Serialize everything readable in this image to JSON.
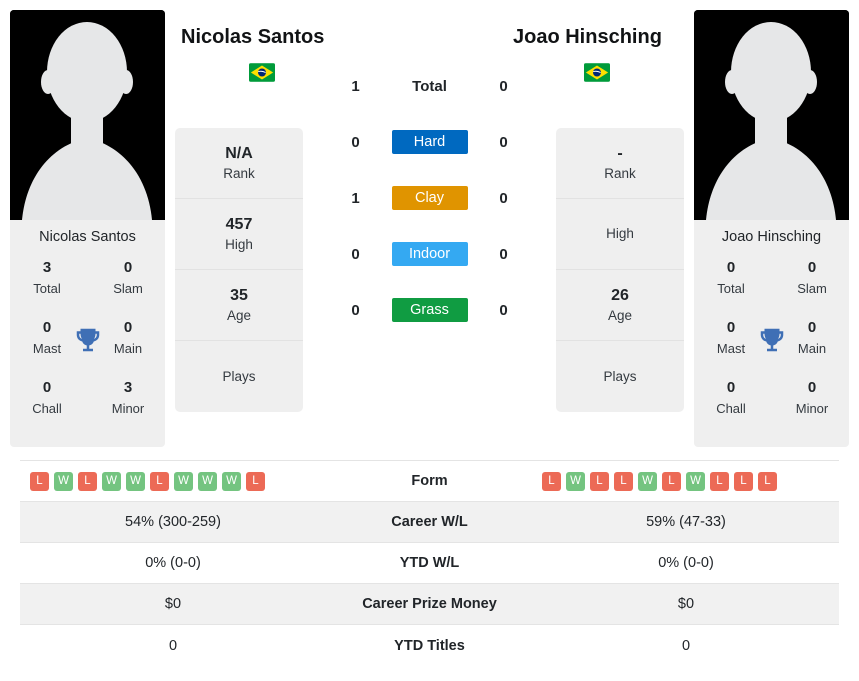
{
  "players": {
    "left": {
      "name": "Nicolas Santos",
      "photo_caption": "Nicolas Santos",
      "country": "Brazil",
      "flag": "brazil-flag",
      "titles": {
        "total_value": "3",
        "total_label": "Total",
        "slam_value": "0",
        "slam_label": "Slam",
        "mast_value": "0",
        "mast_label": "Mast",
        "main_value": "0",
        "main_label": "Main",
        "chall_value": "0",
        "chall_label": "Chall",
        "minor_value": "3",
        "minor_label": "Minor"
      },
      "info": [
        {
          "value": "N/A",
          "label": "Rank"
        },
        {
          "value": "457",
          "label": "High"
        },
        {
          "value": "35",
          "label": "Age"
        },
        {
          "value": "",
          "label": "Plays"
        }
      ],
      "form": [
        "L",
        "W",
        "L",
        "W",
        "W",
        "L",
        "W",
        "W",
        "W",
        "L"
      ],
      "career_wl": "54% (300-259)",
      "ytd_wl": "0% (0-0)",
      "career_prize_money": "$0",
      "ytd_titles": "0"
    },
    "right": {
      "name": "Joao Hinsching",
      "photo_caption": "Joao Hinsching",
      "country": "Brazil",
      "flag": "brazil-flag",
      "titles": {
        "total_value": "0",
        "total_label": "Total",
        "slam_value": "0",
        "slam_label": "Slam",
        "mast_value": "0",
        "mast_label": "Mast",
        "main_value": "0",
        "main_label": "Main",
        "chall_value": "0",
        "chall_label": "Chall",
        "minor_value": "0",
        "minor_label": "Minor"
      },
      "info": [
        {
          "value": "-",
          "label": "Rank"
        },
        {
          "value": "",
          "label": "High"
        },
        {
          "value": "26",
          "label": "Age"
        },
        {
          "value": "",
          "label": "Plays"
        }
      ],
      "form": [
        "L",
        "W",
        "L",
        "L",
        "W",
        "L",
        "W",
        "L",
        "L",
        "L"
      ],
      "career_wl": "59% (47-33)",
      "ytd_wl": "0% (0-0)",
      "career_prize_money": "$0",
      "ytd_titles": "0"
    }
  },
  "head_to_head": {
    "rows": [
      {
        "left": "1",
        "label": "Total",
        "right": "0",
        "type": "total",
        "color": ""
      },
      {
        "left": "0",
        "label": "Hard",
        "right": "0",
        "type": "surface",
        "color": "#0069c0"
      },
      {
        "left": "1",
        "label": "Clay",
        "right": "0",
        "type": "surface",
        "color": "#e09400"
      },
      {
        "left": "0",
        "label": "Indoor",
        "right": "0",
        "type": "surface",
        "color": "#34a9f2"
      },
      {
        "left": "0",
        "label": "Grass",
        "right": "0",
        "type": "surface",
        "color": "#109c42"
      }
    ]
  },
  "comparison_table": {
    "rows": [
      {
        "label": "Form",
        "left": "",
        "right": "",
        "kind": "form"
      },
      {
        "label": "Career W/L",
        "left": "54% (300-259)",
        "right": "59% (47-33)",
        "kind": "text"
      },
      {
        "label": "YTD W/L",
        "left": "0% (0-0)",
        "right": "0% (0-0)",
        "kind": "text"
      },
      {
        "label": "Career Prize Money",
        "left": "$0",
        "right": "$0",
        "kind": "text"
      },
      {
        "label": "YTD Titles",
        "left": "0",
        "right": "0",
        "kind": "text"
      }
    ]
  },
  "colors": {
    "hard": "#0069c0",
    "clay": "#e09400",
    "indoor": "#34a9f2",
    "grass": "#109c42",
    "win": "#74c480",
    "loss": "#ec6a56",
    "trophy": "#3f6fb5",
    "panel_bg": "#efefef"
  }
}
